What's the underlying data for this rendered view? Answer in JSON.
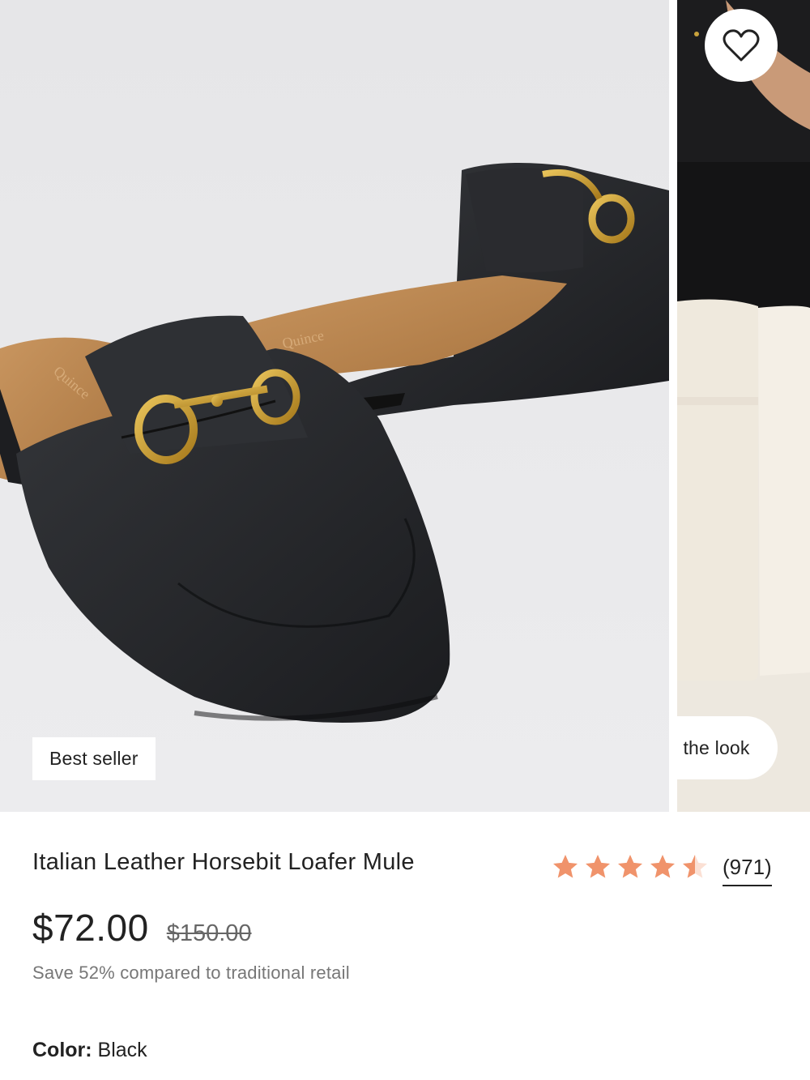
{
  "gallery": {
    "badge": "Best seller",
    "shop_the_look": "Shop the look",
    "brand_imprint": "Quince",
    "icons": {
      "wishlist": "heart-outline-icon"
    }
  },
  "product": {
    "title": "Italian Leather Horsebit Loafer Mule",
    "rating": {
      "value": 4.5,
      "max": 5,
      "count_label": "(971)",
      "star_color": "#f0936b"
    },
    "price": "$72.00",
    "original_price": "$150.00",
    "savings": "Save 52% compared to traditional retail",
    "color": {
      "label": "Color:",
      "value": "Black"
    }
  }
}
